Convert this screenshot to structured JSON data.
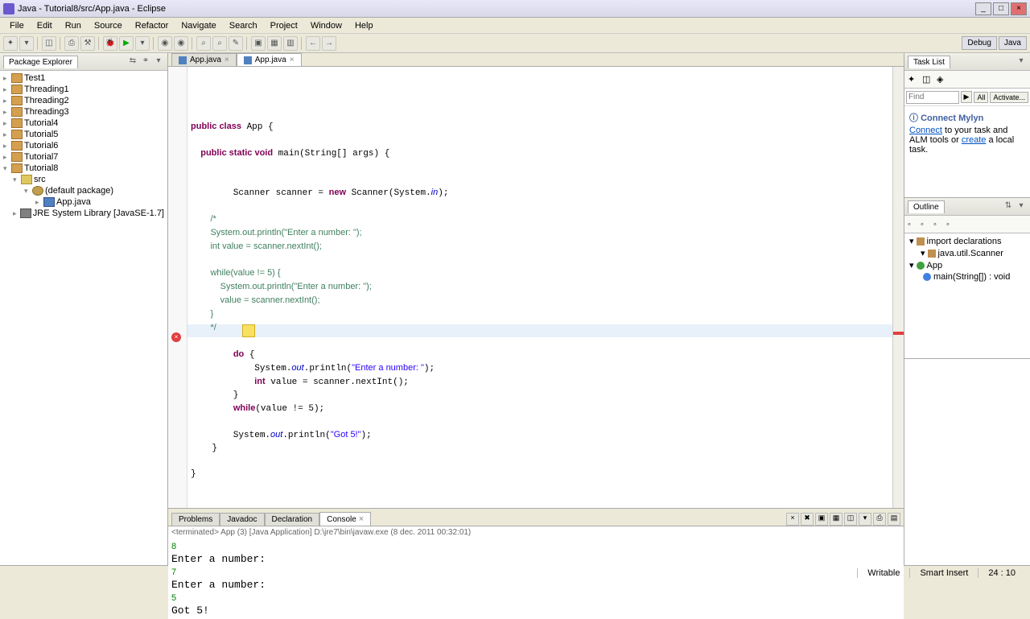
{
  "window": {
    "title": "Java - Tutorial8/src/App.java - Eclipse"
  },
  "menu": [
    "File",
    "Edit",
    "Run",
    "Source",
    "Refactor",
    "Navigate",
    "Search",
    "Project",
    "Window",
    "Help"
  ],
  "perspectives": {
    "debug": "Debug",
    "java": "Java"
  },
  "package_explorer": {
    "title": "Package Explorer",
    "projects": [
      "Test1",
      "Threading1",
      "Threading2",
      "Threading3",
      "Tutorial4",
      "Tutorial5",
      "Tutorial6",
      "Tutorial7",
      "Tutorial8"
    ],
    "src": "src",
    "pkg": "(default package)",
    "file": "App.java",
    "lib": "JRE System Library [JavaSE-1.7]"
  },
  "editor": {
    "tabs": [
      {
        "label": "App.java",
        "active": false
      },
      {
        "label": "App.java",
        "active": true
      }
    ],
    "code_lines": [
      {
        "t": "public class",
        "k": "kw",
        "r": " App {"
      },
      {
        "t": "",
        "r": ""
      },
      {
        "t": "    public static void",
        "k": "kw",
        "r": " main(String[] args) {"
      },
      {
        "t": "",
        "r": ""
      },
      {
        "t": "",
        "r": ""
      },
      {
        "line": "scanner"
      },
      {
        "t": "",
        "r": ""
      },
      {
        "t": "        /*",
        "k": "cm"
      },
      {
        "t": "        System.out.println(\"Enter a number: \");",
        "k": "cm"
      },
      {
        "t": "        int value = scanner.nextInt();",
        "k": "cm"
      },
      {
        "t": "",
        "r": ""
      },
      {
        "t": "        while(value != 5) {",
        "k": "cm"
      },
      {
        "t": "            System.out.println(\"Enter a number: \");",
        "k": "cm"
      },
      {
        "t": "            value = scanner.nextInt();",
        "k": "cm"
      },
      {
        "t": "        }",
        "k": "cm"
      },
      {
        "t": "        */",
        "k": "cm"
      },
      {
        "t": "",
        "r": ""
      },
      {
        "line": "do"
      },
      {
        "line": "sysout"
      },
      {
        "line": "intval"
      },
      {
        "line": "cursor"
      },
      {
        "line": "while"
      },
      {
        "t": "",
        "r": ""
      },
      {
        "line": "got5"
      },
      {
        "t": "    }",
        "r": ""
      },
      {
        "t": "",
        "r": ""
      },
      {
        "t": "}",
        "r": ""
      }
    ]
  },
  "tasklist": {
    "title": "Task List",
    "find": "Find",
    "all": "All",
    "activate": "Activate..."
  },
  "mylyn": {
    "title": "Connect Mylyn",
    "text1": "Connect",
    "text2": " to your task and ALM tools or ",
    "text3": "create",
    "text4": " a local task."
  },
  "outline": {
    "title": "Outline",
    "items": [
      "import declarations",
      "java.util.Scanner",
      "App",
      "main(String[]) : void"
    ]
  },
  "bottom": {
    "tabs": [
      "Problems",
      "Javadoc",
      "Declaration",
      "Console"
    ],
    "active": 3,
    "console_head": "<terminated> App (3) [Java Application] D:\\jre7\\bin\\javaw.exe (8 dec. 2011 00:32:01)",
    "lines": [
      {
        "t": "8",
        "c": "in"
      },
      {
        "t": "Enter a number: ",
        "c": ""
      },
      {
        "t": "7",
        "c": "in"
      },
      {
        "t": "Enter a number: ",
        "c": ""
      },
      {
        "t": "5",
        "c": "in"
      },
      {
        "t": "Got 5!",
        "c": ""
      }
    ]
  },
  "status": {
    "writable": "Writable",
    "insert": "Smart Insert",
    "pos": "24 : 10"
  }
}
